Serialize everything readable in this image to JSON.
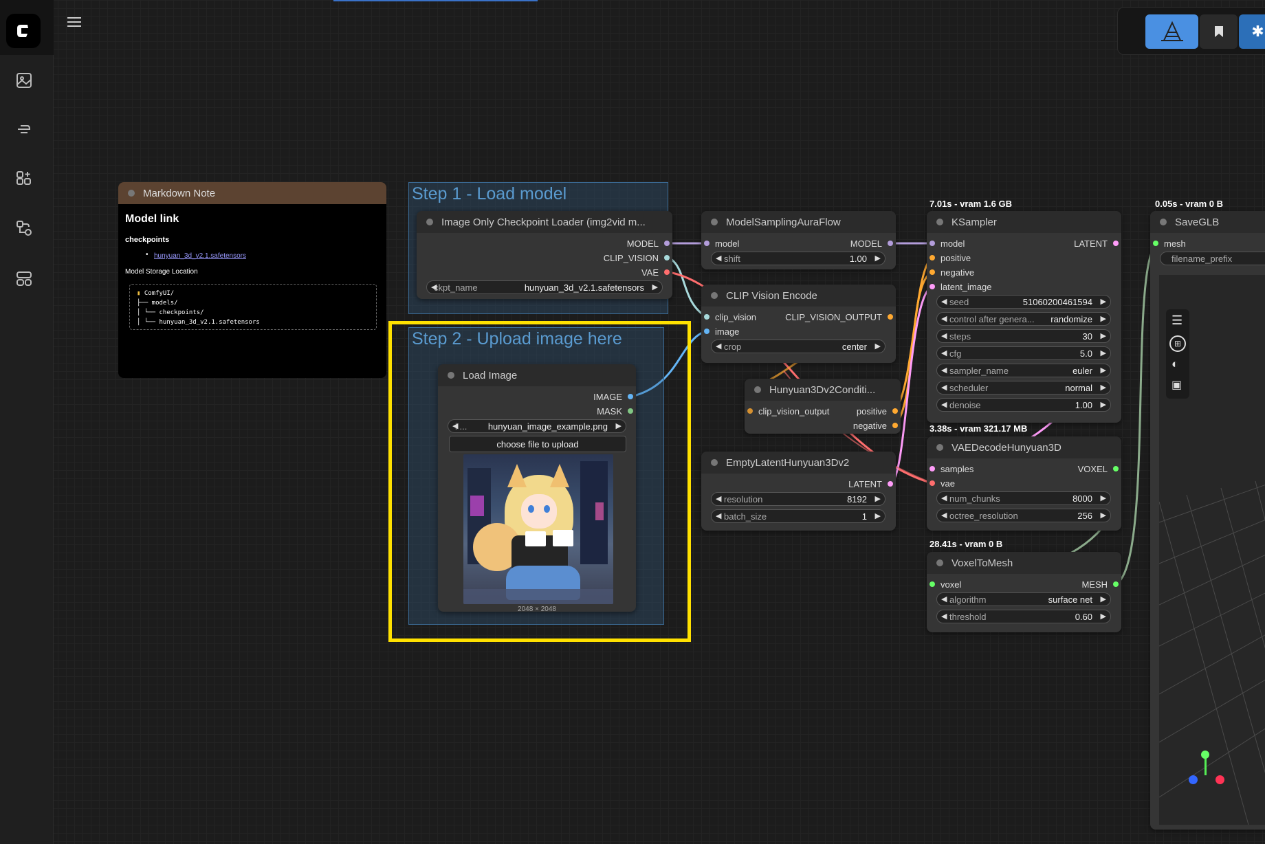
{
  "app": {
    "name": "ComfyUI"
  },
  "sidebar": {
    "icons": [
      "comfy-logo-icon",
      "images-icon",
      "model-library-icon",
      "node-library-icon",
      "workflows-icon",
      "templates-icon"
    ]
  },
  "topbar": {
    "menu_icon": "hamburger-icon",
    "buttons": [
      "3d-viewer-icon",
      "bookmark-icon",
      "extensions-icon"
    ]
  },
  "markdown_note": {
    "title": "Markdown Note",
    "heading": "Model link",
    "subheading": "checkpoints",
    "link": "hunyuan_3d_v2.1.safetensors",
    "storage_label": "Model Storage Location",
    "tree": [
      "ComfyUI/",
      "├── models/",
      "│   └── checkpoints/",
      "│       └── hunyuan_3d_v2.1.safetensors"
    ]
  },
  "groups": {
    "step1": "Step 1 - Load model",
    "step2": "Step 2 - Upload image here"
  },
  "checkpoint_loader": {
    "title": "Image Only Checkpoint Loader (img2vid m...",
    "outputs": [
      "MODEL",
      "CLIP_VISION",
      "VAE"
    ],
    "widget_label": "ckpt_name",
    "widget_value": "hunyuan_3d_v2.1.safetensors"
  },
  "load_image": {
    "title": "Load Image",
    "outputs": [
      "IMAGE",
      "MASK"
    ],
    "widget_label": "i ...",
    "widget_value": "hunyuan_image_example.png",
    "upload_label": "choose file to upload",
    "image_size": "2048 × 2048"
  },
  "model_sampling": {
    "title": "ModelSamplingAuraFlow",
    "input": "model",
    "output": "MODEL",
    "widget_label": "shift",
    "widget_value": "1.00"
  },
  "clip_vision_encode": {
    "title": "CLIP Vision Encode",
    "inputs": [
      "clip_vision",
      "image"
    ],
    "output": "CLIP_VISION_OUTPUT",
    "widget_label": "crop",
    "widget_value": "center"
  },
  "hunyuan_cond": {
    "title": "Hunyuan3Dv2Conditi...",
    "input": "clip_vision_output",
    "outputs": [
      "positive",
      "negative"
    ]
  },
  "empty_latent": {
    "title": "EmptyLatentHunyuan3Dv2",
    "output": "LATENT",
    "widgets": [
      {
        "label": "resolution",
        "value": "8192"
      },
      {
        "label": "batch_size",
        "value": "1"
      }
    ]
  },
  "ksampler": {
    "exec_info": "7.01s - vram 1.6 GB",
    "title": "KSampler",
    "inputs": [
      "model",
      "positive",
      "negative",
      "latent_image"
    ],
    "output": "LATENT",
    "widgets": [
      {
        "label": "seed",
        "value": "51060200461594"
      },
      {
        "label": "control after genera...",
        "value": "randomize"
      },
      {
        "label": "steps",
        "value": "30"
      },
      {
        "label": "cfg",
        "value": "5.0"
      },
      {
        "label": "sampler_name",
        "value": "euler"
      },
      {
        "label": "scheduler",
        "value": "normal"
      },
      {
        "label": "denoise",
        "value": "1.00"
      }
    ]
  },
  "vae_decode": {
    "exec_info": "3.38s - vram 321.17 MB",
    "title": "VAEDecodeHunyuan3D",
    "inputs": [
      "samples",
      "vae"
    ],
    "output": "VOXEL",
    "widgets": [
      {
        "label": "num_chunks",
        "value": "8000"
      },
      {
        "label": "octree_resolution",
        "value": "256"
      }
    ]
  },
  "voxel_to_mesh": {
    "exec_info": "28.41s - vram 0 B",
    "title": "VoxelToMesh",
    "input": "voxel",
    "output": "MESH",
    "widgets": [
      {
        "label": "algorithm",
        "value": "surface net"
      },
      {
        "label": "threshold",
        "value": "0.60"
      }
    ]
  },
  "save_glb": {
    "exec_info": "0.05s - vram 0 B",
    "title": "SaveGLB",
    "input": "mesh",
    "widget_label": "filename_prefix"
  },
  "colors": {
    "model": "#b39ddb",
    "clip_vision": "#a8dadc",
    "vae": "#ff6e6e",
    "image": "#64b5f6",
    "mask": "#81c784",
    "conditioning": "#ffa931",
    "latent": "#ff9cf9",
    "voxel": "#66ff66",
    "highlight": "#ffe100"
  }
}
